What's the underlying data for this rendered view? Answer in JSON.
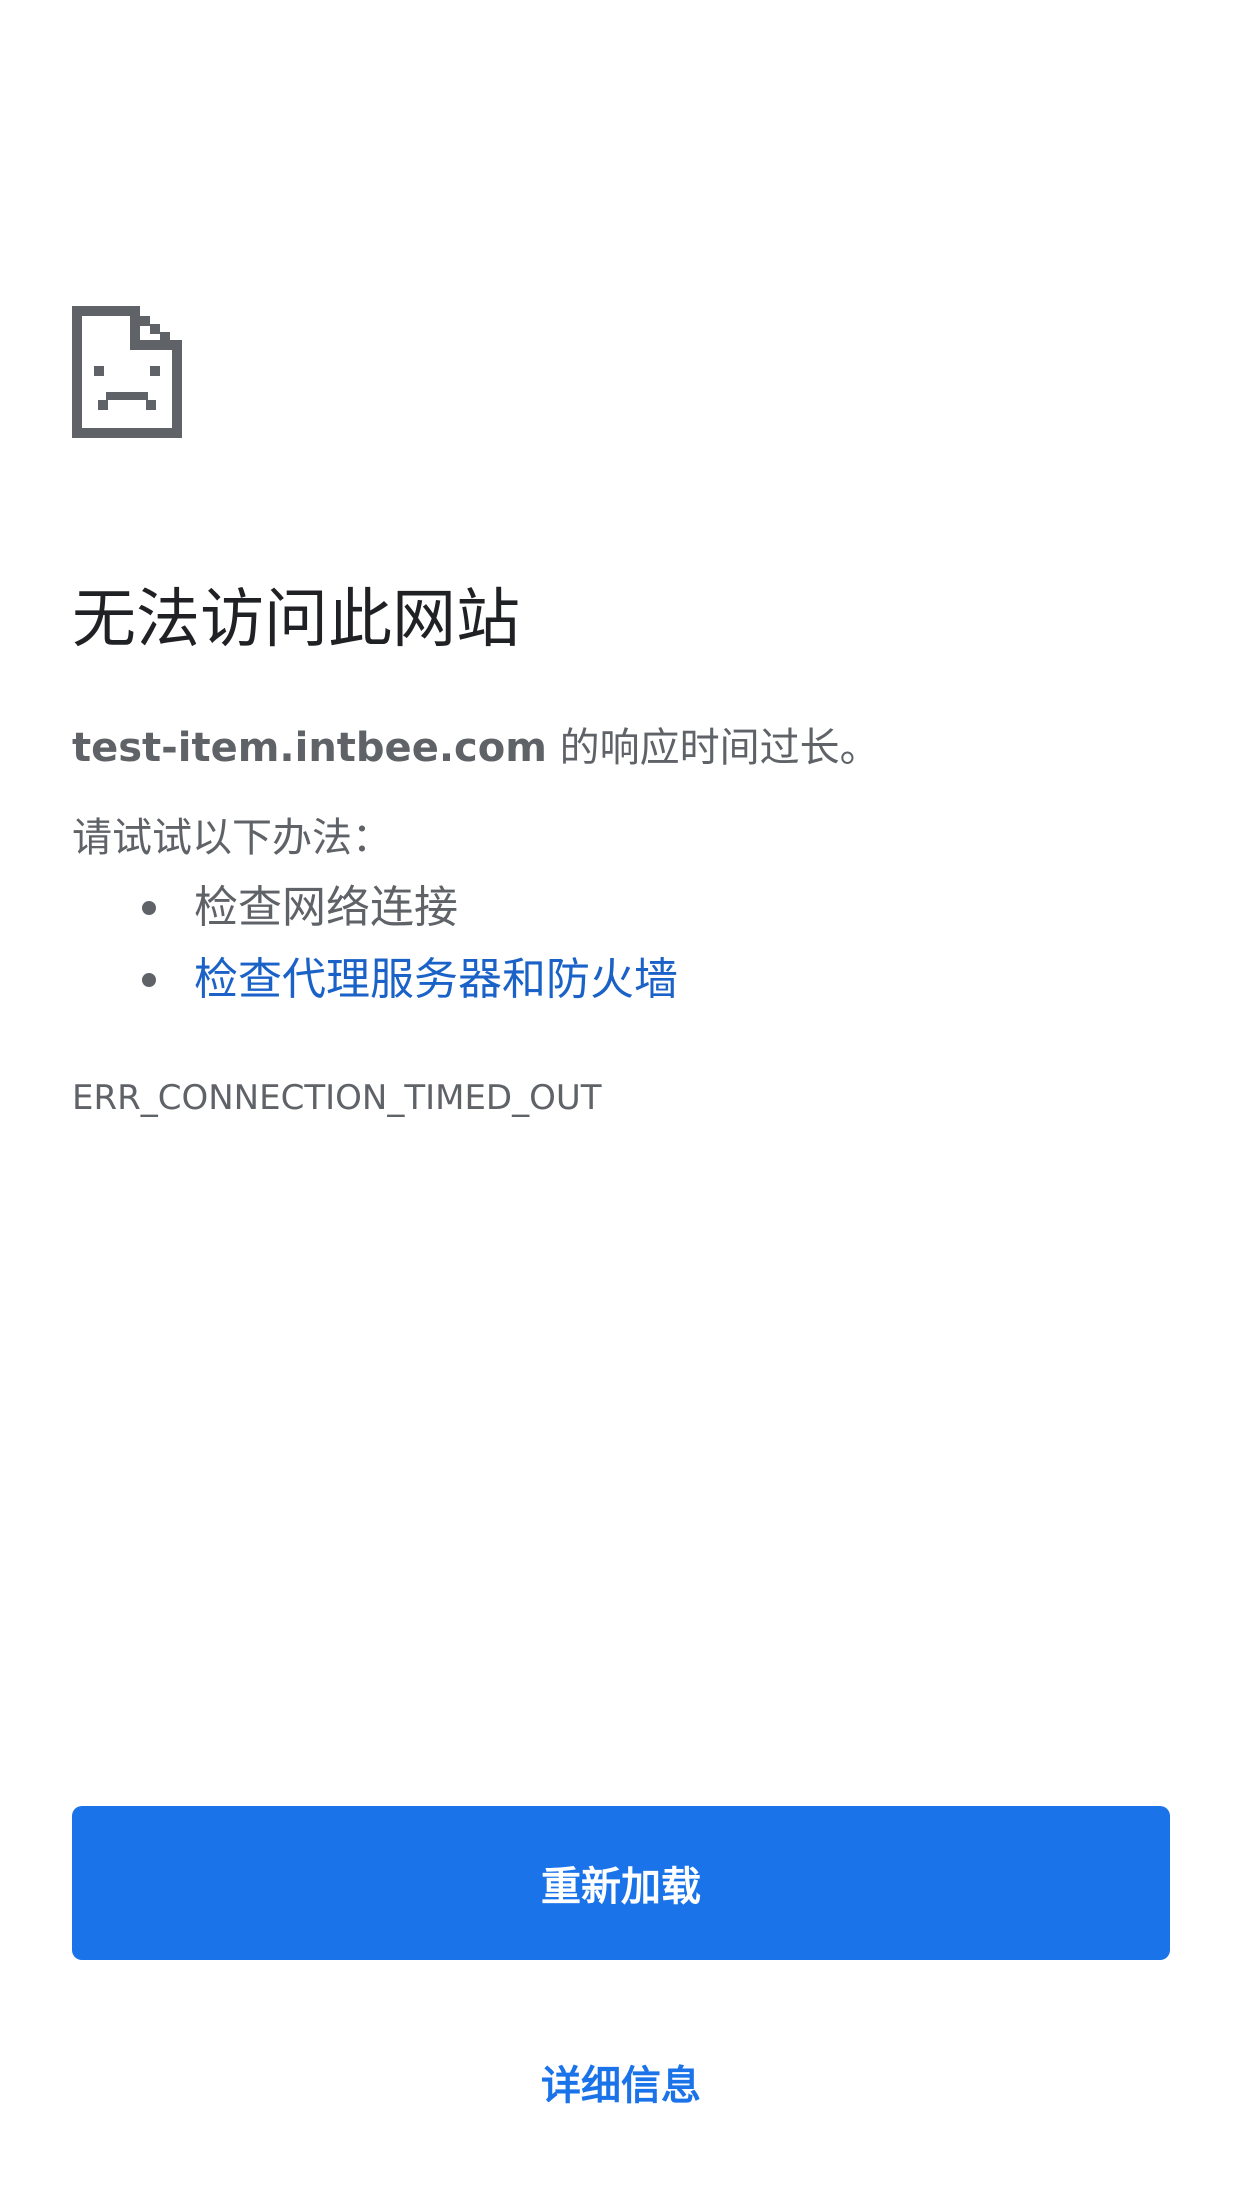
{
  "error": {
    "icon": "sad-page-icon",
    "title": "无法访问此网站",
    "host": "test-item.intbee.com",
    "summary_suffix": " 的响应时间过长。",
    "suggestions_heading": "请试试以下办法：",
    "suggestions": [
      {
        "label": "检查网络连接",
        "link": false
      },
      {
        "label": "检查代理服务器和防火墙",
        "link": true
      }
    ],
    "code": "ERR_CONNECTION_TIMED_OUT"
  },
  "actions": {
    "reload_label": "重新加载",
    "details_label": "详细信息"
  },
  "colors": {
    "accent": "#1a73e8",
    "link": "#1a62c7",
    "text": "#5f6368",
    "title": "#202124",
    "icon": "#5f6368"
  }
}
